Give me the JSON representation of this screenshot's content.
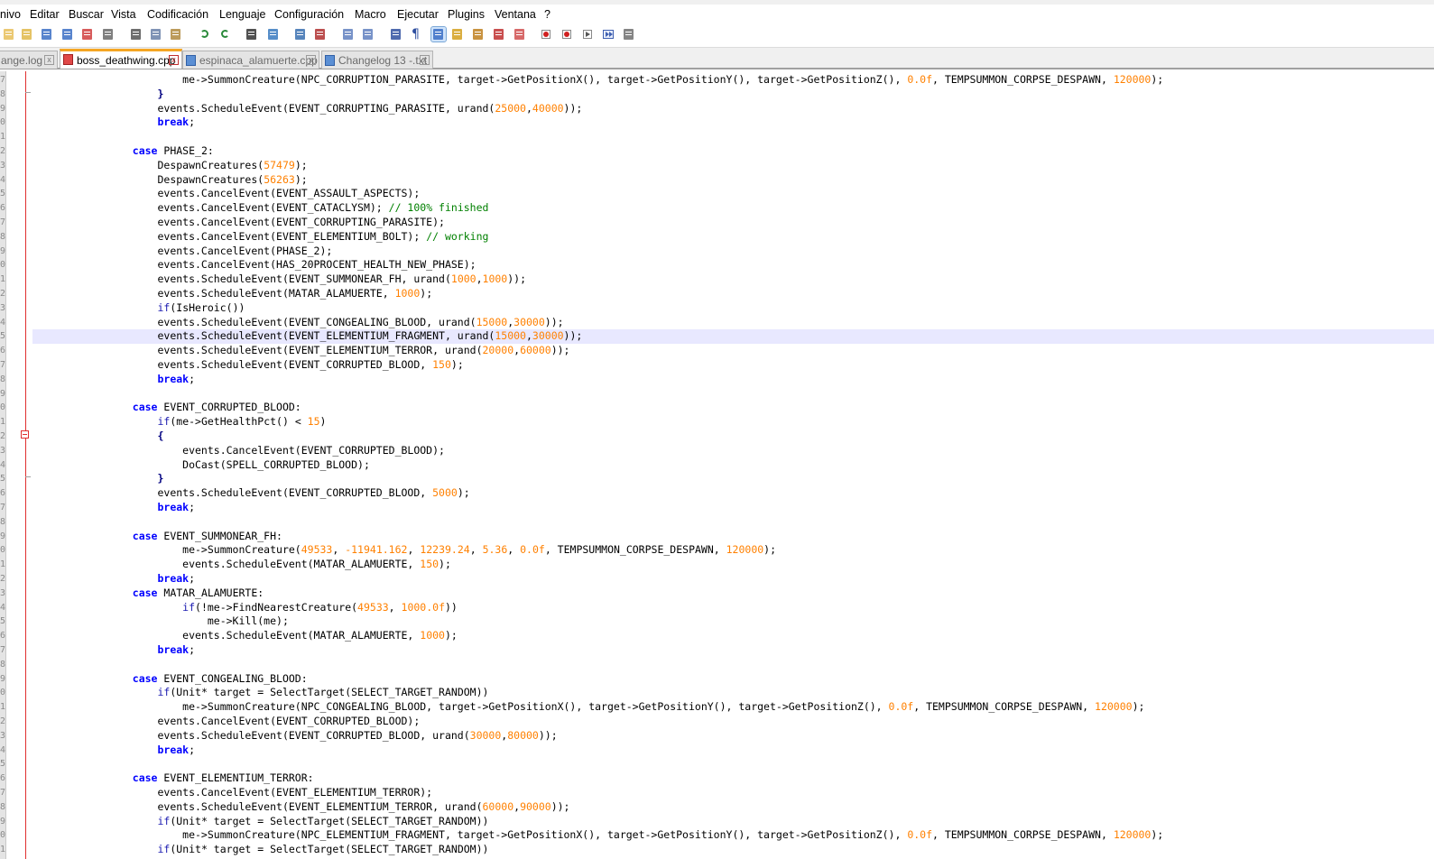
{
  "menu": [
    "nivo",
    "Editar",
    "Buscar",
    "Vista",
    "Codificación",
    "Lenguaje",
    "Configuración",
    "Macro",
    "Ejecutar",
    "Plugins",
    "Ventana",
    "?"
  ],
  "tabs": [
    {
      "label": "ange.log",
      "active": false
    },
    {
      "label": "boss_deathwing.cpp",
      "active": true
    },
    {
      "label": "espinaca_alamuerte.cpp",
      "active": false
    },
    {
      "label": "Changelog 13 -.txt",
      "active": false
    }
  ],
  "tab_close_glyph": "x",
  "line_numbers": [
    "7",
    "8",
    "9",
    "0",
    "1",
    "2",
    "3",
    "4",
    "5",
    "6",
    "7",
    "8",
    "9",
    "0",
    "1",
    "2",
    "3",
    "4",
    "5",
    "6",
    "7",
    "8",
    "9",
    "0",
    "1",
    "2",
    "3",
    "4",
    "5",
    "6",
    "7",
    "8",
    "9",
    "0",
    "1",
    "2",
    "3",
    "4",
    "5",
    "6",
    "7",
    "8",
    "9",
    "0",
    "1",
    "2",
    "3",
    "4",
    "5",
    "6",
    "7",
    "8",
    "9",
    "0",
    "1",
    "2",
    "3"
  ],
  "current_line_index": 18,
  "code_lines": [
    [
      [
        "t",
        "                        me->SummonCreature(NPC_CORRUPTION_PARASITE, target->GetPositionX(), target->GetPositionY(), target->GetPositionZ(), "
      ],
      [
        "n",
        "0.0f"
      ],
      [
        "t",
        ", TEMPSUMMON_CORPSE_DESPAWN, "
      ],
      [
        "n",
        "120000"
      ],
      [
        "t",
        ");"
      ]
    ],
    [
      [
        "t",
        "                    "
      ],
      [
        "o",
        "}"
      ]
    ],
    [
      [
        "t",
        "                    events.ScheduleEvent(EVENT_CORRUPTING_PARASITE, urand("
      ],
      [
        "n",
        "25000"
      ],
      [
        "t",
        ","
      ],
      [
        "n",
        "40000"
      ],
      [
        "t",
        "));"
      ]
    ],
    [
      [
        "t",
        "                    "
      ],
      [
        "k",
        "break"
      ],
      [
        "t",
        ";"
      ]
    ],
    [
      [
        "t",
        ""
      ]
    ],
    [
      [
        "t",
        "                "
      ],
      [
        "k",
        "case"
      ],
      [
        "t",
        " PHASE_2:"
      ]
    ],
    [
      [
        "t",
        "                    DespawnCreatures("
      ],
      [
        "n",
        "57479"
      ],
      [
        "t",
        ");"
      ]
    ],
    [
      [
        "t",
        "                    DespawnCreatures("
      ],
      [
        "n",
        "56263"
      ],
      [
        "t",
        ");"
      ]
    ],
    [
      [
        "t",
        "                    events.CancelEvent(EVENT_ASSAULT_ASPECTS);"
      ]
    ],
    [
      [
        "t",
        "                    events.CancelEvent(EVENT_CATACLYSM); "
      ],
      [
        "c",
        "// 100% finished"
      ]
    ],
    [
      [
        "t",
        "                    events.CancelEvent(EVENT_CORRUPTING_PARASITE);"
      ]
    ],
    [
      [
        "t",
        "                    events.CancelEvent(EVENT_ELEMENTIUM_BOLT); "
      ],
      [
        "c",
        "// working"
      ]
    ],
    [
      [
        "t",
        "                    events.CancelEvent(PHASE_2);"
      ]
    ],
    [
      [
        "t",
        "                    events.CancelEvent(HAS_20PROCENT_HEALTH_NEW_PHASE);"
      ]
    ],
    [
      [
        "t",
        "                    events.ScheduleEvent(EVENT_SUMMONEAR_FH, urand("
      ],
      [
        "n",
        "1000"
      ],
      [
        "t",
        ","
      ],
      [
        "n",
        "1000"
      ],
      [
        "t",
        "));"
      ]
    ],
    [
      [
        "t",
        "                    events.ScheduleEvent(MATAR_ALAMUERTE, "
      ],
      [
        "n",
        "1000"
      ],
      [
        "t",
        ");"
      ]
    ],
    [
      [
        "t",
        "                    "
      ],
      [
        "k2",
        "if"
      ],
      [
        "t",
        "(IsHeroic())"
      ]
    ],
    [
      [
        "t",
        "                    events.ScheduleEvent(EVENT_CONGEALING_BLOOD, urand("
      ],
      [
        "n",
        "15000"
      ],
      [
        "t",
        ","
      ],
      [
        "n",
        "30000"
      ],
      [
        "t",
        "));"
      ]
    ],
    [
      [
        "t",
        "                    events.ScheduleEvent(EVENT_ELEMENTIUM_FRAGMENT, urand("
      ],
      [
        "n",
        "15000"
      ],
      [
        "t",
        ","
      ],
      [
        "n",
        "30000"
      ],
      [
        "t",
        "));"
      ]
    ],
    [
      [
        "t",
        "                    events.ScheduleEvent(EVENT_ELEMENTIUM_TERROR, urand("
      ],
      [
        "n",
        "20000"
      ],
      [
        "t",
        ","
      ],
      [
        "n",
        "60000"
      ],
      [
        "t",
        "));"
      ]
    ],
    [
      [
        "t",
        "                    events.ScheduleEvent(EVENT_CORRUPTED_BLOOD, "
      ],
      [
        "n",
        "150"
      ],
      [
        "t",
        ");"
      ]
    ],
    [
      [
        "t",
        "                    "
      ],
      [
        "k",
        "break"
      ],
      [
        "t",
        ";"
      ]
    ],
    [
      [
        "t",
        ""
      ]
    ],
    [
      [
        "t",
        "                "
      ],
      [
        "k",
        "case"
      ],
      [
        "t",
        " EVENT_CORRUPTED_BLOOD:"
      ]
    ],
    [
      [
        "t",
        "                    "
      ],
      [
        "k2",
        "if"
      ],
      [
        "t",
        "(me->GetHealthPct() < "
      ],
      [
        "n",
        "15"
      ],
      [
        "t",
        ")"
      ]
    ],
    [
      [
        "t",
        "                    "
      ],
      [
        "o",
        "{"
      ]
    ],
    [
      [
        "t",
        "                        events.CancelEvent(EVENT_CORRUPTED_BLOOD);"
      ]
    ],
    [
      [
        "t",
        "                        DoCast(SPELL_CORRUPTED_BLOOD);"
      ]
    ],
    [
      [
        "t",
        "                    "
      ],
      [
        "o",
        "}"
      ]
    ],
    [
      [
        "t",
        "                    events.ScheduleEvent(EVENT_CORRUPTED_BLOOD, "
      ],
      [
        "n",
        "5000"
      ],
      [
        "t",
        ");"
      ]
    ],
    [
      [
        "t",
        "                    "
      ],
      [
        "k",
        "break"
      ],
      [
        "t",
        ";"
      ]
    ],
    [
      [
        "t",
        ""
      ]
    ],
    [
      [
        "t",
        "                "
      ],
      [
        "k",
        "case"
      ],
      [
        "t",
        " EVENT_SUMMONEAR_FH:"
      ]
    ],
    [
      [
        "t",
        "                        me->SummonCreature("
      ],
      [
        "n",
        "49533"
      ],
      [
        "t",
        ", "
      ],
      [
        "n",
        "-11941.162"
      ],
      [
        "t",
        ", "
      ],
      [
        "n",
        "12239.24"
      ],
      [
        "t",
        ", "
      ],
      [
        "n",
        "5.36"
      ],
      [
        "t",
        ", "
      ],
      [
        "n",
        "0.0f"
      ],
      [
        "t",
        ", TEMPSUMMON_CORPSE_DESPAWN, "
      ],
      [
        "n",
        "120000"
      ],
      [
        "t",
        ");"
      ]
    ],
    [
      [
        "t",
        "                        events.ScheduleEvent(MATAR_ALAMUERTE, "
      ],
      [
        "n",
        "150"
      ],
      [
        "t",
        ");"
      ]
    ],
    [
      [
        "t",
        "                    "
      ],
      [
        "k",
        "break"
      ],
      [
        "t",
        ";"
      ]
    ],
    [
      [
        "t",
        "                "
      ],
      [
        "k",
        "case"
      ],
      [
        "t",
        " MATAR_ALAMUERTE:"
      ]
    ],
    [
      [
        "t",
        "                        "
      ],
      [
        "k2",
        "if"
      ],
      [
        "t",
        "(!me->FindNearestCreature("
      ],
      [
        "n",
        "49533"
      ],
      [
        "t",
        ", "
      ],
      [
        "n",
        "1000.0f"
      ],
      [
        "t",
        "))"
      ]
    ],
    [
      [
        "t",
        "                            me->Kill(me);"
      ]
    ],
    [
      [
        "t",
        "                        events.ScheduleEvent(MATAR_ALAMUERTE, "
      ],
      [
        "n",
        "1000"
      ],
      [
        "t",
        ");"
      ]
    ],
    [
      [
        "t",
        "                    "
      ],
      [
        "k",
        "break"
      ],
      [
        "t",
        ";"
      ]
    ],
    [
      [
        "t",
        ""
      ]
    ],
    [
      [
        "t",
        "                "
      ],
      [
        "k",
        "case"
      ],
      [
        "t",
        " EVENT_CONGEALING_BLOOD:"
      ]
    ],
    [
      [
        "t",
        "                    "
      ],
      [
        "k2",
        "if"
      ],
      [
        "t",
        "(Unit* target = SelectTarget(SELECT_TARGET_RANDOM))"
      ]
    ],
    [
      [
        "t",
        "                        me->SummonCreature(NPC_CONGEALING_BLOOD, target->GetPositionX(), target->GetPositionY(), target->GetPositionZ(), "
      ],
      [
        "n",
        "0.0f"
      ],
      [
        "t",
        ", TEMPSUMMON_CORPSE_DESPAWN, "
      ],
      [
        "n",
        "120000"
      ],
      [
        "t",
        ");"
      ]
    ],
    [
      [
        "t",
        "                    events.CancelEvent(EVENT_CORRUPTED_BLOOD);"
      ]
    ],
    [
      [
        "t",
        "                    events.ScheduleEvent(EVENT_CORRUPTED_BLOOD, urand("
      ],
      [
        "n",
        "30000"
      ],
      [
        "t",
        ","
      ],
      [
        "n",
        "80000"
      ],
      [
        "t",
        "));"
      ]
    ],
    [
      [
        "t",
        "                    "
      ],
      [
        "k",
        "break"
      ],
      [
        "t",
        ";"
      ]
    ],
    [
      [
        "t",
        ""
      ]
    ],
    [
      [
        "t",
        "                "
      ],
      [
        "k",
        "case"
      ],
      [
        "t",
        " EVENT_ELEMENTIUM_TERROR:"
      ]
    ],
    [
      [
        "t",
        "                    events.CancelEvent(EVENT_ELEMENTIUM_TERROR);"
      ]
    ],
    [
      [
        "t",
        "                    events.ScheduleEvent(EVENT_ELEMENTIUM_TERROR, urand("
      ],
      [
        "n",
        "60000"
      ],
      [
        "t",
        ","
      ],
      [
        "n",
        "90000"
      ],
      [
        "t",
        "));"
      ]
    ],
    [
      [
        "t",
        "                    "
      ],
      [
        "k2",
        "if"
      ],
      [
        "t",
        "(Unit* target = SelectTarget(SELECT_TARGET_RANDOM))"
      ]
    ],
    [
      [
        "t",
        "                        me->SummonCreature(NPC_ELEMENTIUM_FRAGMENT, target->GetPositionX(), target->GetPositionY(), target->GetPositionZ(), "
      ],
      [
        "n",
        "0.0f"
      ],
      [
        "t",
        ", TEMPSUMMON_CORPSE_DESPAWN, "
      ],
      [
        "n",
        "120000"
      ],
      [
        "t",
        ");"
      ]
    ],
    [
      [
        "t",
        "                    "
      ],
      [
        "k2",
        "if"
      ],
      [
        "t",
        "(Unit* target = SelectTarget(SELECT_TARGET_RANDOM))"
      ]
    ]
  ],
  "toolbar": [
    "new-file-icon",
    "open-file-icon",
    "save-icon",
    "save-all-icon",
    "close-icon",
    "close-all-icon",
    "print-icon",
    "cut-icon",
    "copy-icon",
    "paste-icon",
    "undo-icon",
    "redo-icon",
    "find-icon",
    "replace-icon",
    "zoom-in-icon",
    "zoom-out-icon",
    "sync-vertical-icon",
    "sync-horizontal-icon",
    "word-wrap-icon",
    "show-all-chars-icon",
    "indent-guide-icon",
    "user-lang-icon",
    "doc-map-icon",
    "function-list-icon",
    "folder-workspace-icon",
    "record-macro-icon",
    "stop-record-icon",
    "play-macro-icon",
    "run-macro-multiple-icon",
    "save-macro-icon"
  ],
  "colors": {
    "keyword": "#0000ff",
    "number": "#ff8000",
    "comment": "#008000",
    "fold_line": "#e03030",
    "current_line": "#e8e8ff",
    "active_tab_accent": "#f5a623"
  }
}
